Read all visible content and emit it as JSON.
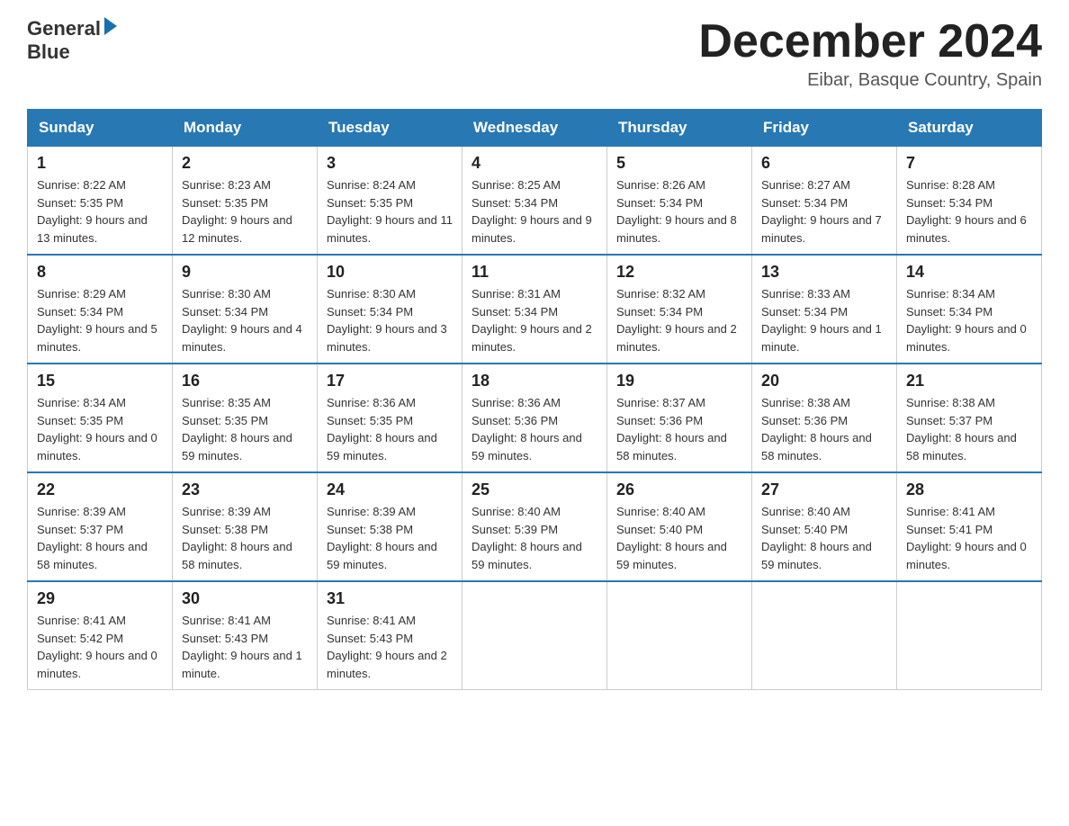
{
  "header": {
    "logo_line1": "General",
    "logo_line2": "Blue",
    "month_title": "December 2024",
    "location": "Eibar, Basque Country, Spain"
  },
  "days_of_week": [
    "Sunday",
    "Monday",
    "Tuesday",
    "Wednesday",
    "Thursday",
    "Friday",
    "Saturday"
  ],
  "weeks": [
    [
      {
        "day": "1",
        "sunrise": "8:22 AM",
        "sunset": "5:35 PM",
        "daylight": "9 hours and 13 minutes."
      },
      {
        "day": "2",
        "sunrise": "8:23 AM",
        "sunset": "5:35 PM",
        "daylight": "9 hours and 12 minutes."
      },
      {
        "day": "3",
        "sunrise": "8:24 AM",
        "sunset": "5:35 PM",
        "daylight": "9 hours and 11 minutes."
      },
      {
        "day": "4",
        "sunrise": "8:25 AM",
        "sunset": "5:34 PM",
        "daylight": "9 hours and 9 minutes."
      },
      {
        "day": "5",
        "sunrise": "8:26 AM",
        "sunset": "5:34 PM",
        "daylight": "9 hours and 8 minutes."
      },
      {
        "day": "6",
        "sunrise": "8:27 AM",
        "sunset": "5:34 PM",
        "daylight": "9 hours and 7 minutes."
      },
      {
        "day": "7",
        "sunrise": "8:28 AM",
        "sunset": "5:34 PM",
        "daylight": "9 hours and 6 minutes."
      }
    ],
    [
      {
        "day": "8",
        "sunrise": "8:29 AM",
        "sunset": "5:34 PM",
        "daylight": "9 hours and 5 minutes."
      },
      {
        "day": "9",
        "sunrise": "8:30 AM",
        "sunset": "5:34 PM",
        "daylight": "9 hours and 4 minutes."
      },
      {
        "day": "10",
        "sunrise": "8:30 AM",
        "sunset": "5:34 PM",
        "daylight": "9 hours and 3 minutes."
      },
      {
        "day": "11",
        "sunrise": "8:31 AM",
        "sunset": "5:34 PM",
        "daylight": "9 hours and 2 minutes."
      },
      {
        "day": "12",
        "sunrise": "8:32 AM",
        "sunset": "5:34 PM",
        "daylight": "9 hours and 2 minutes."
      },
      {
        "day": "13",
        "sunrise": "8:33 AM",
        "sunset": "5:34 PM",
        "daylight": "9 hours and 1 minute."
      },
      {
        "day": "14",
        "sunrise": "8:34 AM",
        "sunset": "5:34 PM",
        "daylight": "9 hours and 0 minutes."
      }
    ],
    [
      {
        "day": "15",
        "sunrise": "8:34 AM",
        "sunset": "5:35 PM",
        "daylight": "9 hours and 0 minutes."
      },
      {
        "day": "16",
        "sunrise": "8:35 AM",
        "sunset": "5:35 PM",
        "daylight": "8 hours and 59 minutes."
      },
      {
        "day": "17",
        "sunrise": "8:36 AM",
        "sunset": "5:35 PM",
        "daylight": "8 hours and 59 minutes."
      },
      {
        "day": "18",
        "sunrise": "8:36 AM",
        "sunset": "5:36 PM",
        "daylight": "8 hours and 59 minutes."
      },
      {
        "day": "19",
        "sunrise": "8:37 AM",
        "sunset": "5:36 PM",
        "daylight": "8 hours and 58 minutes."
      },
      {
        "day": "20",
        "sunrise": "8:38 AM",
        "sunset": "5:36 PM",
        "daylight": "8 hours and 58 minutes."
      },
      {
        "day": "21",
        "sunrise": "8:38 AM",
        "sunset": "5:37 PM",
        "daylight": "8 hours and 58 minutes."
      }
    ],
    [
      {
        "day": "22",
        "sunrise": "8:39 AM",
        "sunset": "5:37 PM",
        "daylight": "8 hours and 58 minutes."
      },
      {
        "day": "23",
        "sunrise": "8:39 AM",
        "sunset": "5:38 PM",
        "daylight": "8 hours and 58 minutes."
      },
      {
        "day": "24",
        "sunrise": "8:39 AM",
        "sunset": "5:38 PM",
        "daylight": "8 hours and 59 minutes."
      },
      {
        "day": "25",
        "sunrise": "8:40 AM",
        "sunset": "5:39 PM",
        "daylight": "8 hours and 59 minutes."
      },
      {
        "day": "26",
        "sunrise": "8:40 AM",
        "sunset": "5:40 PM",
        "daylight": "8 hours and 59 minutes."
      },
      {
        "day": "27",
        "sunrise": "8:40 AM",
        "sunset": "5:40 PM",
        "daylight": "8 hours and 59 minutes."
      },
      {
        "day": "28",
        "sunrise": "8:41 AM",
        "sunset": "5:41 PM",
        "daylight": "9 hours and 0 minutes."
      }
    ],
    [
      {
        "day": "29",
        "sunrise": "8:41 AM",
        "sunset": "5:42 PM",
        "daylight": "9 hours and 0 minutes."
      },
      {
        "day": "30",
        "sunrise": "8:41 AM",
        "sunset": "5:43 PM",
        "daylight": "9 hours and 1 minute."
      },
      {
        "day": "31",
        "sunrise": "8:41 AM",
        "sunset": "5:43 PM",
        "daylight": "9 hours and 2 minutes."
      },
      null,
      null,
      null,
      null
    ]
  ]
}
